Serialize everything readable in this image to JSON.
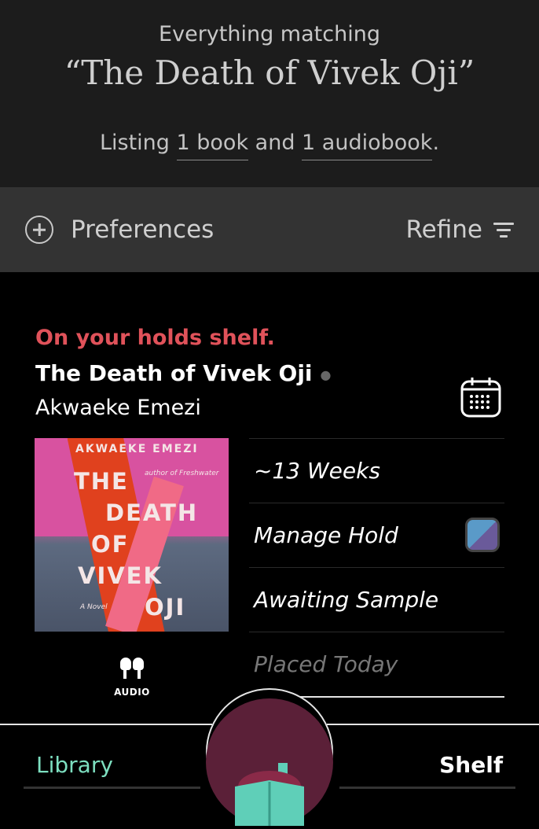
{
  "header": {
    "eyebrow": "Everything matching",
    "query": "“The Death of Vivek Oji”",
    "listing_prefix": "Listing ",
    "listing_books": "1 book",
    "listing_mid": " and ",
    "listing_audiobooks": "1 audiobook",
    "listing_suffix": "."
  },
  "toolbar": {
    "preferences_label": "Preferences",
    "refine_label": "Refine"
  },
  "result": {
    "status": "On your holds shelf.",
    "title": "The Death of Vivek Oji",
    "author": "Akwaeke Emezi",
    "format_label": "AUDIO",
    "cover": {
      "author_line": "AKWAEKE EMEZI",
      "tagline": "author of Freshwater",
      "title_lines": [
        "THE",
        "DEATH",
        "OF",
        "VIVEK",
        "OJI"
      ],
      "subtitle": "A Novel"
    },
    "actions": [
      {
        "label": "~13 Weeks"
      },
      {
        "label": "Manage Hold"
      },
      {
        "label": "Awaiting Sample"
      },
      {
        "label": "Placed Today"
      }
    ]
  },
  "tabs": {
    "library": "Library",
    "shelf": "Shelf"
  },
  "colors": {
    "status_red": "#e0525a",
    "library_green": "#7ddfc0",
    "fab_maroon": "#5b2038"
  }
}
